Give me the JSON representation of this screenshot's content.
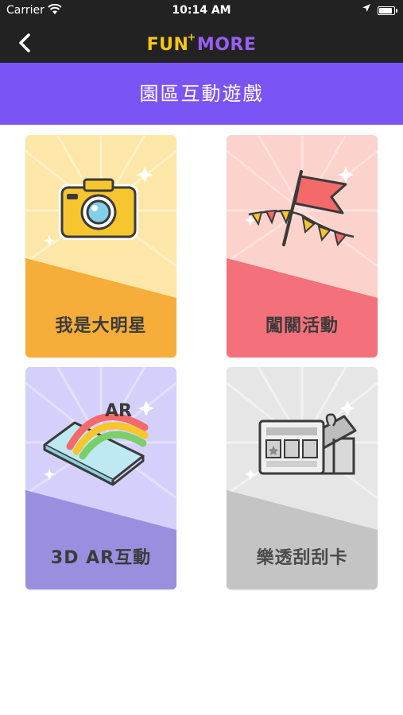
{
  "status_bar": {
    "carrier": "Carrier",
    "time": "10:14 AM",
    "battery_level": 0.95
  },
  "nav": {
    "logo_fun": "FUN",
    "logo_plus": "+",
    "logo_more": "MORE",
    "back_icon": "chevron-left-icon"
  },
  "page": {
    "title": "園區互動遊戲"
  },
  "cards": [
    {
      "label": "我是大明星",
      "icon": "camera-icon",
      "top_color": "#fde7a8",
      "bottom_color": "#f6ad3a"
    },
    {
      "label": "闖關活動",
      "icon": "flag-bunting-icon",
      "top_color": "#fcd2cc",
      "bottom_color": "#f4707a"
    },
    {
      "label": "3D AR互動",
      "icon": "ar-phone-icon",
      "top_color": "#d4d0fb",
      "bottom_color": "#9a8fdf"
    },
    {
      "label": "樂透刮刮卡",
      "icon": "scratch-card-gift-icon",
      "top_color": "#e6e6e6",
      "bottom_color": "#c4c4c4"
    }
  ],
  "colors": {
    "brand_purple": "#7b54f6",
    "dark_bar": "#222222",
    "logo_yellow": "#f6c417",
    "logo_purple": "#9a5ef3"
  }
}
